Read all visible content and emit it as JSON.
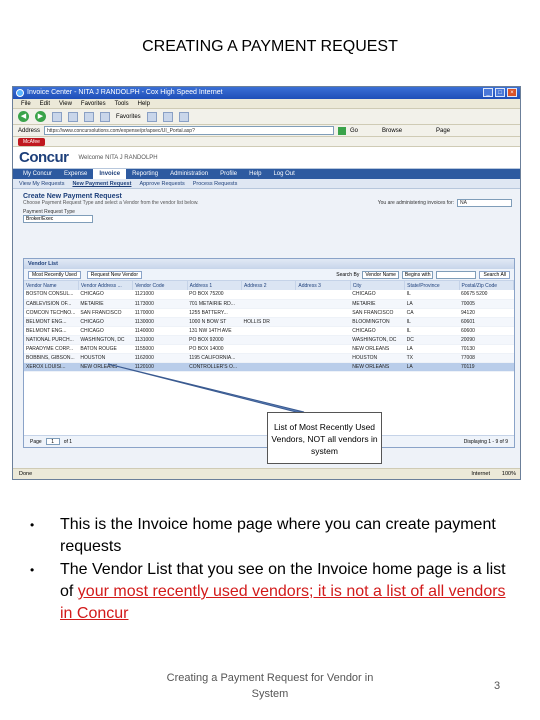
{
  "slide": {
    "title": "CREATING A PAYMENT REQUEST",
    "callout": "List of Most Recently Used Vendors, NOT all vendors in system",
    "bullets": [
      {
        "text_before": "This is the Invoice home page where you can create payment requests",
        "text_red": ""
      },
      {
        "text_before": "The Vendor List that you see on the Invoice home page is a list of ",
        "text_red": "your most recently used vendors; it is not a list of all vendors in Concur"
      }
    ],
    "footer": "Creating a Payment Request for Vendor in System",
    "page_number": "3"
  },
  "browser": {
    "title": "Invoice Center - NITA J RANDOLPH - Cox High Speed Internet",
    "menu": [
      "File",
      "Edit",
      "View",
      "Favorites",
      "Tools",
      "Help"
    ],
    "address_label": "Address",
    "address_value": "https://www.concursolutions.com/expense/pr/apsec/UI_Portal.asp?",
    "go_label": "Go",
    "favorites_label": "Favorites",
    "browse_label": "Browse",
    "page_label": "Page",
    "mcafee": "McAfee",
    "status_text": "Done",
    "zone_text": "Internet",
    "zoom_text": "100%"
  },
  "concur": {
    "logo": "Concur",
    "welcome": "Welcome  NITA J RANDOLPH",
    "nav": [
      "My Concur",
      "Expense",
      "Invoice",
      "Reporting",
      "Administration",
      "Profile",
      "Help",
      "Log Out"
    ],
    "nav_active_index": 2,
    "subnav": [
      "View My Requests",
      "New Payment Request",
      "Approve Requests",
      "Process Requests"
    ],
    "subnav_active_index": 1,
    "admin_label": "You are administering invoices for:",
    "admin_value": "NA",
    "create_title": "Create New Payment Request",
    "create_hint": "Choose Payment Request Type and select a Vendor from the vendor list below.",
    "type_label": "Payment Request Type",
    "type_value": "Broker/Exec"
  },
  "vendor_list": {
    "title": "Vendor List",
    "most_recent_btn": "Most Recently Used",
    "new_vendor_btn": "Request New Vendor",
    "search_label": "Search By",
    "search_field": "Vendor Name",
    "search_op": "Begins with",
    "search_btn": "Search All",
    "columns": [
      "Vendor Name",
      "Vendor Address ...",
      "Vendor Code",
      "Address 1",
      "Address 2",
      "Address 3",
      "City",
      "State/Province",
      "Postal/Zip Code"
    ],
    "rows": [
      [
        "BOSTON CONSUL...",
        "CHICAGO",
        "1121000",
        "PO BOX 75200",
        "",
        "",
        "CHICAGO",
        "IL",
        "60675 5200"
      ],
      [
        "CABLEVISION OF...",
        "METAIRIE",
        "1173000",
        "701 METAIRIE RD...",
        "",
        "",
        "METAIRIE",
        "LA",
        "70005"
      ],
      [
        "COMCON TECHNO...",
        "SAN FRANCISCO",
        "1170000",
        "1255 BATTERY...",
        "",
        "",
        "SAN FRANCISCO",
        "CA",
        "94120"
      ],
      [
        "BELMONT ENG...",
        "CHICAGO",
        "1130000",
        "1000 N BOW ST",
        "HOLLIS DR",
        "",
        "BLOOMINGTON",
        "IL",
        "60601"
      ],
      [
        "BELMONT ENG...",
        "CHICAGO",
        "1140000",
        "131 NW 14TH AVE",
        "",
        "",
        "CHICAGO",
        "IL",
        "60600"
      ],
      [
        "NATIONAL PURCH...",
        "WASHINGTON, DC",
        "1131000",
        "PO BOX 92000",
        "",
        "",
        "WASHINGTON, DC",
        "DC",
        "20090"
      ],
      [
        "PARADYME CORP...",
        "BATON ROUGE",
        "1155000",
        "PO BOX 14000",
        "",
        "",
        "NEW ORLEANS",
        "LA",
        "70130"
      ],
      [
        "BOBBINS, GIBSON...",
        "HOUSTON",
        "1162000",
        "1195 CALIFORNIA...",
        "",
        "",
        "HOUSTON",
        "TX",
        "77008"
      ],
      [
        "XEROX LOUISI...",
        "NEW ORLEANS",
        "1120100",
        "CONTROLLER'S O...",
        "",
        "",
        "NEW ORLEANS",
        "LA",
        "70119"
      ]
    ],
    "selected_row": 8,
    "page_label": "Page",
    "page_value": "1",
    "page_of": "of 1",
    "display_text": "Displaying 1 - 9 of 9"
  },
  "colors": {
    "accent": "#1d3f7a",
    "emphasis": "#d21a1a"
  }
}
